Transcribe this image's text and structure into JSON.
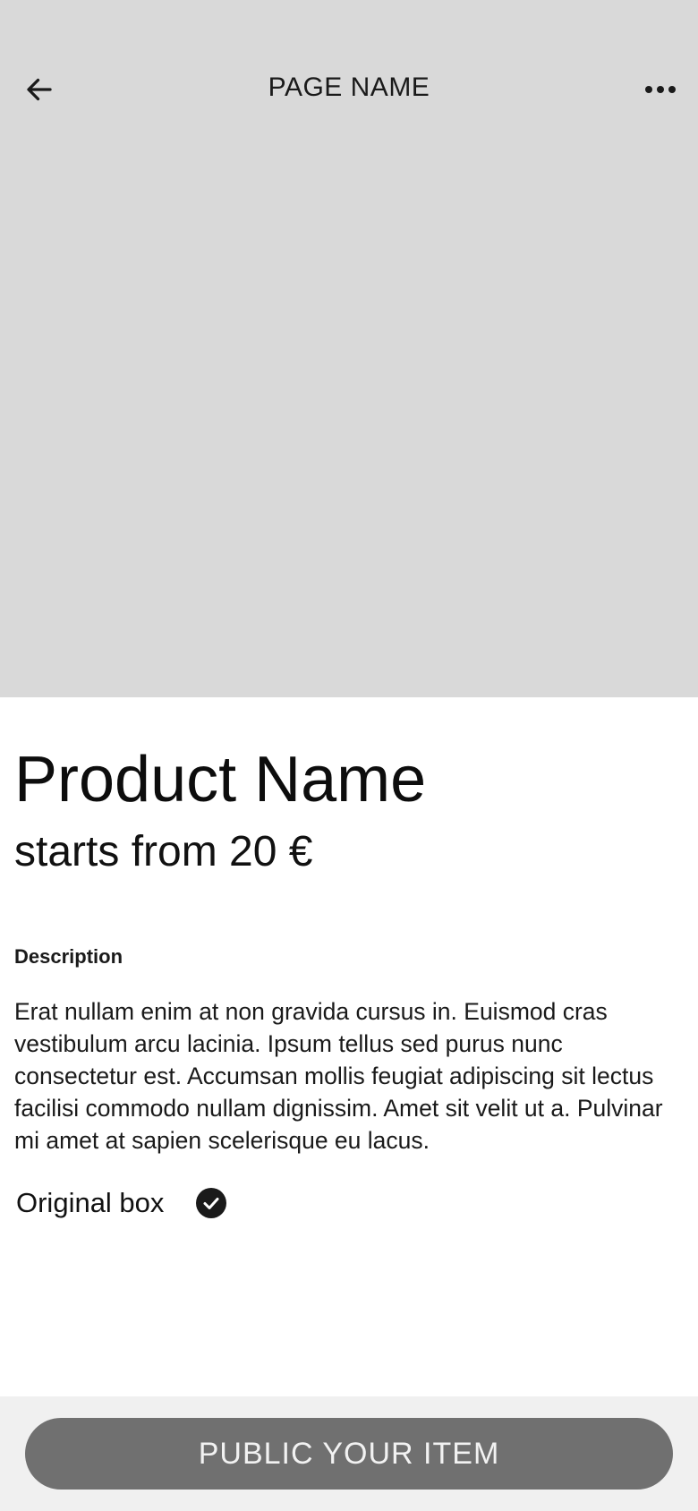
{
  "header": {
    "title": "PAGE NAME",
    "back_icon": "arrow-left-icon",
    "more_icon": "more-horizontal-icon"
  },
  "product": {
    "name": "Product Name",
    "price": "starts from 20 €",
    "description_label": "Description",
    "description": "Erat nullam enim at non gravida cursus in. Euismod cras vestibulum arcu lacinia. Ipsum tellus sed purus nunc consectetur est. Accumsan mollis feugiat adipiscing sit lectus facilisi commodo nullam dignissim. Amet sit velit ut a. Pulvinar mi amet at sapien scelerisque eu lacus.",
    "original_box_label": "Original box",
    "original_box_checked": true,
    "check_icon": "check-circle-icon"
  },
  "footer": {
    "publish_label": "PUBLIC YOUR ITEM"
  },
  "colors": {
    "hero_placeholder": "#d9d9d9",
    "button_bg": "#707070",
    "button_text": "#f2f2f2",
    "footer_bg": "#f0f0f0",
    "text": "#111111"
  }
}
